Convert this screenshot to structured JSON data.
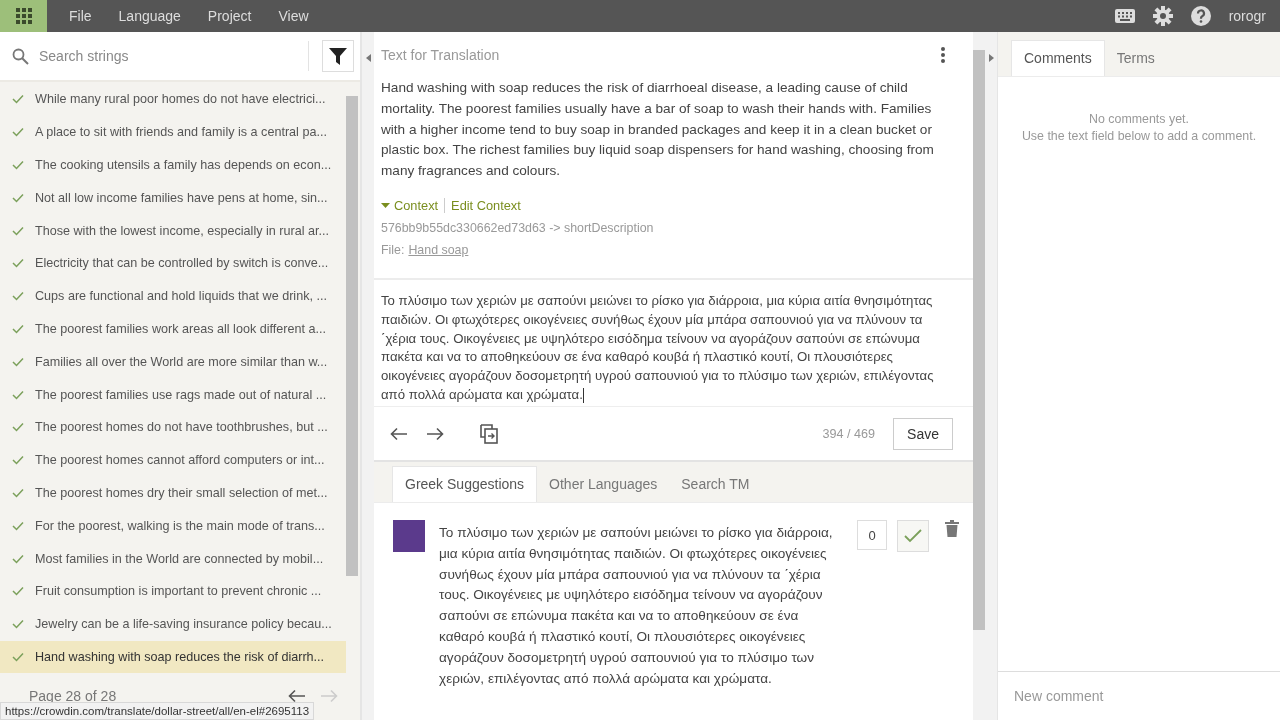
{
  "topbar": {
    "menu": [
      "File",
      "Language",
      "Project",
      "View"
    ],
    "username": "rorogr"
  },
  "strings_panel": {
    "search_placeholder": "Search strings",
    "items": [
      {
        "text": "While many rural poor homes do not have electrici...",
        "translated": true,
        "selected": false
      },
      {
        "text": "A place to sit with friends and family is a central pa...",
        "translated": true,
        "selected": false
      },
      {
        "text": "The cooking utensils a family has depends on econ...",
        "translated": true,
        "selected": false
      },
      {
        "text": "Not all low income families have pens at home, sin...",
        "translated": true,
        "selected": false
      },
      {
        "text": "Those with the lowest income, especially in rural ar...",
        "translated": true,
        "selected": false
      },
      {
        "text": "Electricity that can be controlled by switch is conve...",
        "translated": true,
        "selected": false
      },
      {
        "text": "Cups are functional and hold liquids that we drink, ...",
        "translated": true,
        "selected": false
      },
      {
        "text": "The poorest families work areas all look different a...",
        "translated": true,
        "selected": false
      },
      {
        "text": "Families all over the World are more similar than w...",
        "translated": true,
        "selected": false
      },
      {
        "text": "The poorest families use rags made out of natural ...",
        "translated": true,
        "selected": false
      },
      {
        "text": "The poorest homes do not have toothbrushes, but ...",
        "translated": true,
        "selected": false
      },
      {
        "text": "The poorest homes cannot afford computers or int...",
        "translated": true,
        "selected": false
      },
      {
        "text": "The poorest homes dry their small selection of met...",
        "translated": true,
        "selected": false
      },
      {
        "text": "For the poorest, walking is the main mode of trans...",
        "translated": true,
        "selected": false
      },
      {
        "text": "Most families in the World are connected by mobil...",
        "translated": true,
        "selected": false
      },
      {
        "text": "Fruit consumption is important to prevent chronic ...",
        "translated": true,
        "selected": false
      },
      {
        "text": "Jewelry can be a life-saving insurance policy becau...",
        "translated": true,
        "selected": false
      },
      {
        "text": "Hand washing with soap reduces the risk of diarrh...",
        "translated": true,
        "selected": true
      }
    ],
    "page": "Page 28 of 28",
    "prev_enabled": true,
    "next_enabled": false
  },
  "source": {
    "header": "Text for Translation",
    "text": "Hand washing with soap reduces the risk of diarrhoeal disease, a leading cause of child mortality. The poorest families usually have a bar of soap to wash their hands with. Families with a higher income tend to buy soap in branded packages and keep it in a clean bucket or plastic box. The richest families buy liquid soap dispensers for hand washing, choosing from many fragrances and colours.",
    "context_label": "Context",
    "edit_context": "Edit Context",
    "key": "576bb9b55dc330662ed73d63 -> shortDescription",
    "file_label": "File:",
    "file_name": "Hand soap"
  },
  "editor": {
    "value": "Το πλύσιμο των χεριών με σαπούνι μειώνει το ρίσκο για διάρροια, μια κύρια αιτία θνησιμότητας παιδιών. Οι φτωχότερες οικογένειες συνήθως έχουν μία μπάρα σαπουνιού για να πλύνουν τα ΄χέρια τους. Οικογένειες με υψηλότερο εισόδημα τείνουν να αγοράζουν σαπούνι σε επώνυμα πακέτα και να το αποθηκεύουν σε ένα καθαρό κουβά ή πλαστικό κουτί, Οι πλουσιότερες οικογένειες αγοράζουν δοσομετρητή υγρού σαπουνιού για το πλύσιμο των χεριών, επιλέγοντας από πολλά αρώματα και χρώματα.",
    "counter": "394 / 469",
    "save": "Save"
  },
  "suggestion_tabs": [
    {
      "label": "Greek Suggestions",
      "selected": true
    },
    {
      "label": "Other Languages",
      "selected": false
    },
    {
      "label": "Search TM",
      "selected": false
    }
  ],
  "suggestions": [
    {
      "text": "Το πλύσιμο των χεριών με σαπούνι μειώνει το ρίσκο για διάρροια, μια κύρια αιτία θνησιμότητας παιδιών. Οι φτωχότερες οικογένειες συνήθως έχουν μία μπάρα σαπουνιού για να πλύνουν τα ΄χέρια τους. Οικογένειες με υψηλότερο εισόδημα τείνουν να αγοράζουν σαπούνι σε επώνυμα πακέτα και να το αποθηκεύουν σε ένα καθαρό κουβά ή πλαστικό κουτί, Οι πλουσιότερες οικογένειες αγοράζουν δοσομετρητή υγρού σαπουνιού για το πλύσιμο των χεριών, επιλέγοντας από πολλά αρώματα και χρώματα.",
      "votes": "0",
      "approved": false
    }
  ],
  "side_tabs": [
    {
      "label": "Comments",
      "selected": true
    },
    {
      "label": "Terms",
      "selected": false
    }
  ],
  "comments": {
    "empty_lines": [
      "No comments yet.",
      "Use the text field below to add a comment."
    ],
    "placeholder": "New comment"
  },
  "status_url": "https://crowdin.com/translate/dollar-street/all/en-el#2695113"
}
